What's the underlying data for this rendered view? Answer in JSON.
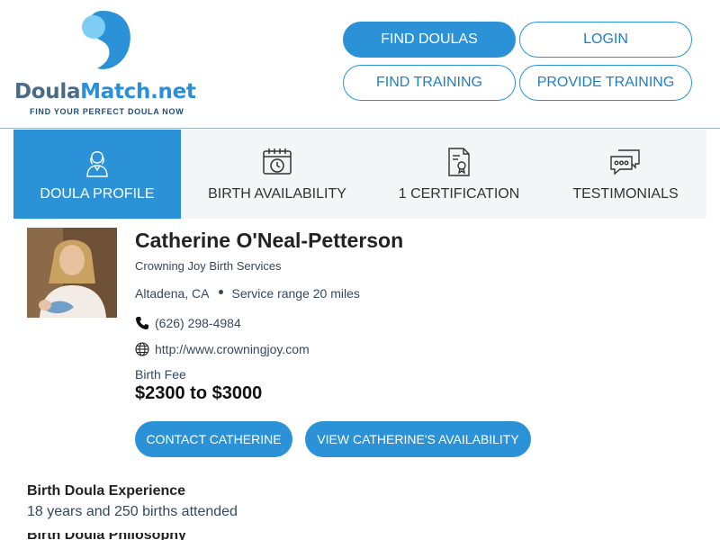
{
  "brand": {
    "name_part1": "Doula",
    "name_part2": "Match.net",
    "tagline": "FIND YOUR PERFECT DOULA NOW"
  },
  "nav": {
    "find_doulas": "FIND DOULAS",
    "login": "LOGIN",
    "find_training": "FIND TRAINING",
    "provide_training": "PROVIDE TRAINING"
  },
  "tabs": [
    {
      "label": "DOULA PROFILE",
      "icon": "person-icon",
      "active": true
    },
    {
      "label": "BIRTH AVAILABILITY",
      "icon": "calendar-clock-icon",
      "active": false
    },
    {
      "label": "1 CERTIFICATION",
      "icon": "certificate-icon",
      "active": false
    },
    {
      "label": "TESTIMONIALS",
      "icon": "chat-bubbles-icon",
      "active": false
    }
  ],
  "profile": {
    "name": "Catherine O'Neal-Petterson",
    "business": "Crowning Joy Birth Services",
    "location": "Altadena, CA",
    "service_range": "Service range 20 miles",
    "phone": "(626) 298-4984",
    "website": "http://www.crowningjoy.com",
    "fee_label": "Birth Fee",
    "fee": "$2300 to $3000"
  },
  "actions": {
    "contact": "CONTACT CATHERINE",
    "availability": "VIEW CATHERINE'S AVAILABILITY"
  },
  "experience": {
    "title": "Birth Doula Experience",
    "text": "18 years and 250 births attended",
    "next_heading_partial": "Birth Doula Philosophy"
  },
  "colors": {
    "accent": "#2b92d8",
    "tab_bg": "#f4f5f6",
    "text_secondary": "#34495e"
  }
}
